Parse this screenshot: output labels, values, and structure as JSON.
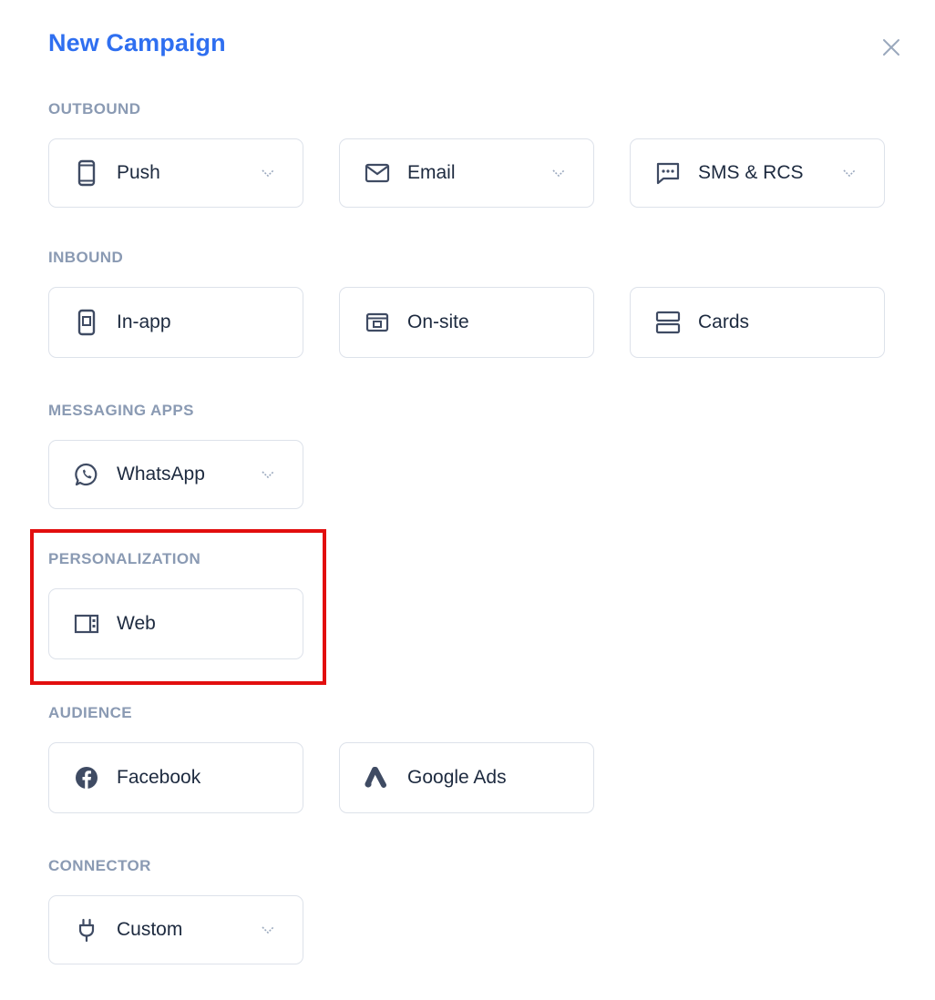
{
  "modal": {
    "title": "New Campaign",
    "close_icon": "close-icon"
  },
  "colors": {
    "title": "#2f6ff0",
    "section_label": "#8a9ab3",
    "card_border": "#dde2ea",
    "icon": "#3f4b63",
    "highlight": "#e20e0e"
  },
  "sections": {
    "outbound": {
      "label": "OUTBOUND",
      "items": [
        {
          "label": "Push",
          "icon": "mobile-phone-icon",
          "has_dropdown": true
        },
        {
          "label": "Email",
          "icon": "envelope-icon",
          "has_dropdown": true
        },
        {
          "label": "SMS & RCS",
          "icon": "chat-bubble-icon",
          "has_dropdown": true
        }
      ]
    },
    "inbound": {
      "label": "INBOUND",
      "items": [
        {
          "label": "In-app",
          "icon": "in-app-phone-icon",
          "has_dropdown": false
        },
        {
          "label": "On-site",
          "icon": "browser-window-icon",
          "has_dropdown": false
        },
        {
          "label": "Cards",
          "icon": "stacked-cards-icon",
          "has_dropdown": false
        }
      ]
    },
    "messaging_apps": {
      "label": "MESSAGING APPS",
      "items": [
        {
          "label": "WhatsApp",
          "icon": "whatsapp-icon",
          "has_dropdown": true
        }
      ]
    },
    "personalization": {
      "label": "PERSONALIZATION",
      "items": [
        {
          "label": "Web",
          "icon": "web-layout-icon",
          "has_dropdown": false
        }
      ]
    },
    "audience": {
      "label": "AUDIENCE",
      "items": [
        {
          "label": "Facebook",
          "icon": "facebook-icon",
          "has_dropdown": false
        },
        {
          "label": "Google Ads",
          "icon": "google-ads-icon",
          "has_dropdown": false
        }
      ]
    },
    "connector": {
      "label": "CONNECTOR",
      "items": [
        {
          "label": "Custom",
          "icon": "plug-icon",
          "has_dropdown": true
        }
      ]
    }
  }
}
